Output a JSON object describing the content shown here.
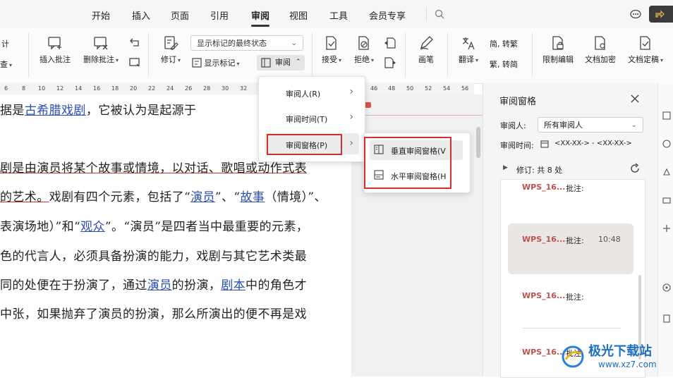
{
  "tabs": [
    "开始",
    "插入",
    "页面",
    "引用",
    "审阅",
    "视图",
    "工具",
    "会员专享"
  ],
  "active_tab": "审阅",
  "ribbon": {
    "left_partial_top": "计",
    "left_partial_bottom": "查",
    "insert_comment": "插入批注",
    "delete_comment": "删除批注",
    "track_changes": "修订",
    "markup_state": "显示标记的最终状态",
    "show_markup": "显示标记",
    "review": "审阅",
    "accept": "接受",
    "reject": "拒绝",
    "pen": "画笔",
    "translate": "翻译",
    "to_traditional": "简, 转繁",
    "to_simplified": "繁, 转简",
    "restrict_edit": "限制编辑",
    "doc_encrypt": "文档加密",
    "doc_finalize": "文档定稿"
  },
  "ruler": [
    "6",
    "8",
    "10",
    "12",
    "14",
    "16",
    "18",
    "20",
    "22",
    "24",
    "26",
    "28",
    "30",
    "32",
    "46",
    "48",
    "50",
    "52",
    "54",
    "56"
  ],
  "document": {
    "l1_a": "据是",
    "l1_link": "古希腊戏剧",
    "l1_b": "，它被认为是起源于",
    "l2": "剧是由演员将某个故事或情境，以对话、歌唱或动作式表",
    "l3_a": "的艺术。",
    "l3_b": "戏剧有四个元素，包括了“",
    "l3_link1": "演员",
    "l3_c": "”、“",
    "l3_link2": "故事",
    "l3_d": "（情境）”、",
    "l4_a": "表演场地）”和“",
    "l4_link": "观众",
    "l4_b": "”。“演员”是四者当中最重要的元素，",
    "l5": "色的代言人，必须具备扮演的能力，戏剧与其它艺术类最",
    "l6_a": "同的处便在于扮演了，通过",
    "l6_link1": "演员",
    "l6_b": "的扮演，",
    "l6_link2": "剧本",
    "l6_c": "中的角色才",
    "l7": "中张，如果抛弃了演员的扮演，那么所演出的便不再是戏"
  },
  "menu1": {
    "items": [
      "审阅人(R)",
      "审阅时间(T)",
      "审阅窗格(P)"
    ]
  },
  "menu2": {
    "items": [
      "垂直审阅窗格(V",
      "水平审阅窗格(H"
    ]
  },
  "panel": {
    "title": "审阅窗格",
    "reviewer_label": "审阅人:",
    "reviewer_value": "所有审阅人",
    "time_label": "审阅时间:",
    "time_value": "<XX-XX-> - <XX-XX->",
    "revisions": "修订:  共 8 处",
    "comments": [
      {
        "author": "WPS_16...",
        "label": "批注:",
        "time": ""
      },
      {
        "author": "WPS_16...",
        "label": "批注:",
        "time": "10:48"
      },
      {
        "author": "WPS_16...",
        "label": "批注:",
        "time": ""
      },
      {
        "author": "WPS_16...",
        "label": "批注:",
        "time": ""
      }
    ]
  },
  "watermark": {
    "line1": "极光下载站",
    "line2": "www.xz7.com"
  },
  "colors": {
    "accent_red": "#d0302f",
    "link_blue": "#2b4fb5",
    "author_red": "#c0504d"
  }
}
